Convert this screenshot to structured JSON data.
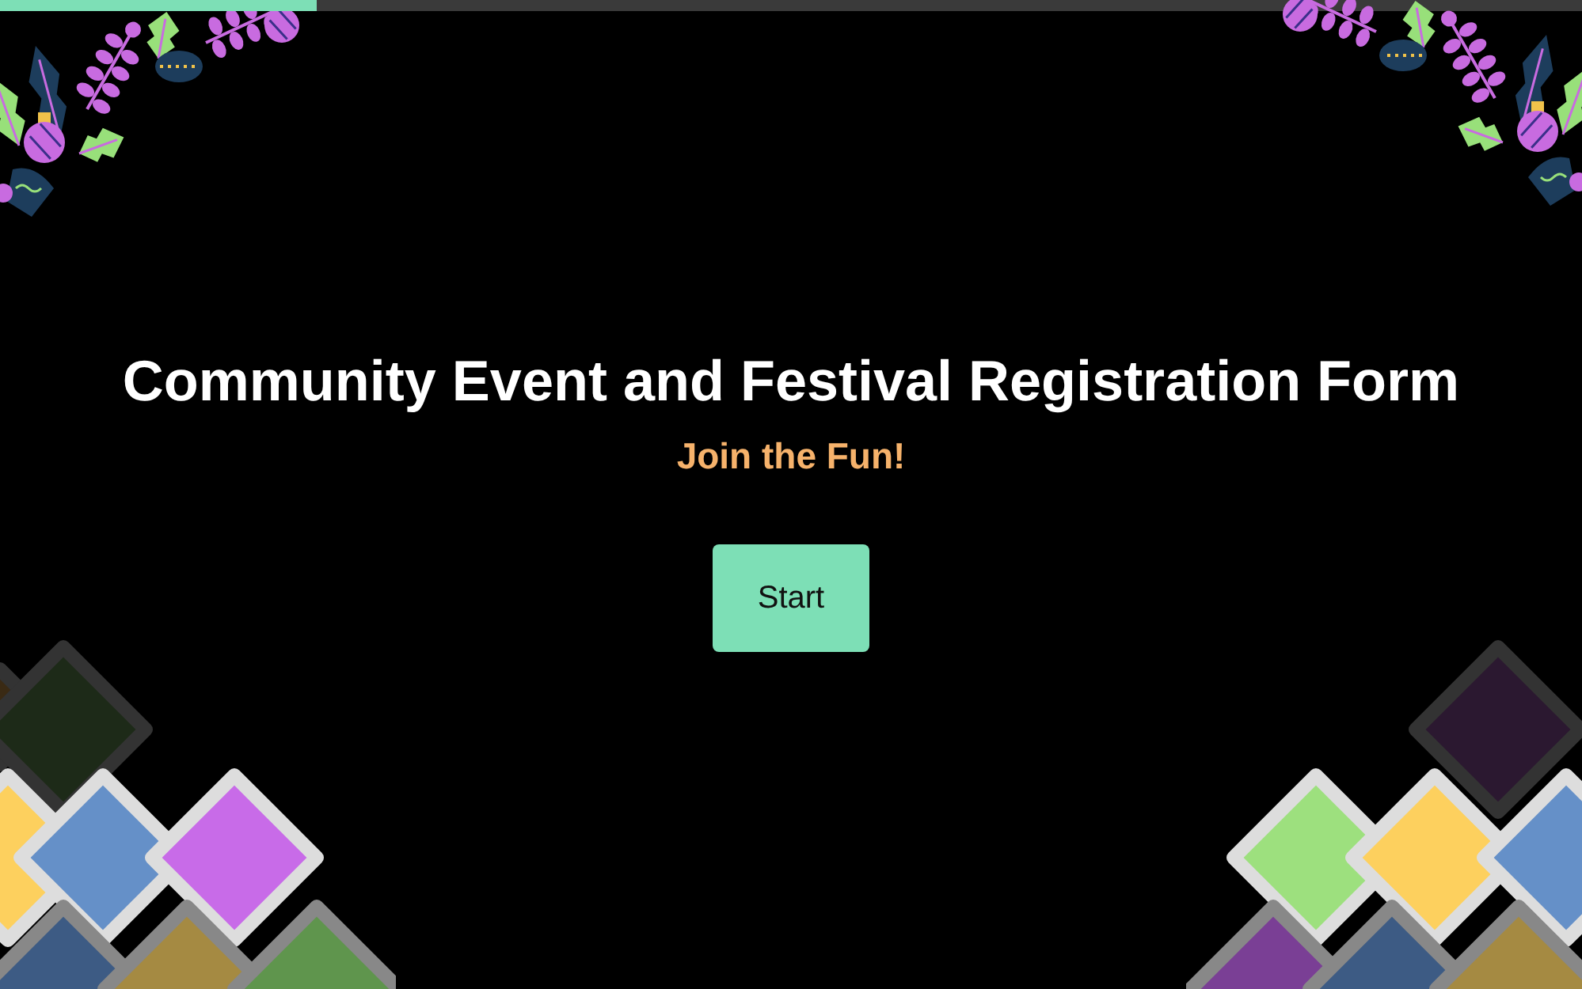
{
  "progress": {
    "level": 0.2
  },
  "title": "Community Event and Festival Registration Form",
  "subtitle": "Join the Fun!",
  "start_button": {
    "label": "Start"
  }
}
